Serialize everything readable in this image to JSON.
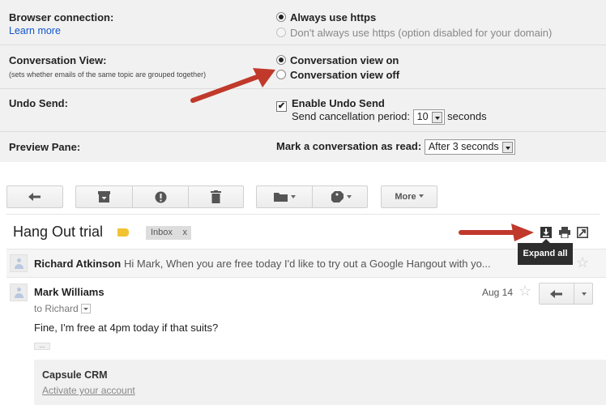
{
  "settings": {
    "browser_connection": {
      "label": "Browser connection:",
      "link": "Learn more",
      "option_on": "Always use https",
      "option_off": "Don't always use https (option disabled for your domain)"
    },
    "conversation_view": {
      "label": "Conversation View:",
      "sub": "(sets whether emails of the same topic are grouped together)",
      "option_on": "Conversation view on",
      "option_off": "Conversation view off"
    },
    "undo_send": {
      "label": "Undo Send:",
      "checkbox_label": "Enable Undo Send",
      "period_label": "Send cancellation period:",
      "period_value": "10",
      "period_unit": "seconds"
    },
    "preview_pane": {
      "label": "Preview Pane:",
      "mark_label": "Mark a conversation as read:",
      "mark_value": "After 3 seconds"
    }
  },
  "toolbar": {
    "more_label": "More"
  },
  "thread": {
    "subject": "Hang Out trial",
    "label_chip": "Inbox",
    "label_chip_remove": "x",
    "tooltip": "Expand all",
    "messages": [
      {
        "sender": "Richard Atkinson",
        "snippet": "Hi Mark, When you are free today I'd like to try out a Google Hangout with yo..."
      },
      {
        "sender": "Mark Williams",
        "date": "Aug 14",
        "to": "to Richard",
        "body": "Fine, I'm free at 4pm today if that suits?"
      }
    ],
    "capsule": {
      "title": "Capsule CRM",
      "action": "Activate your account"
    }
  },
  "colors": {
    "arrow": "#c0392b",
    "label_tag": "#f1c232",
    "link": "#1155cc",
    "settings_bg": "#f1f1f1"
  }
}
